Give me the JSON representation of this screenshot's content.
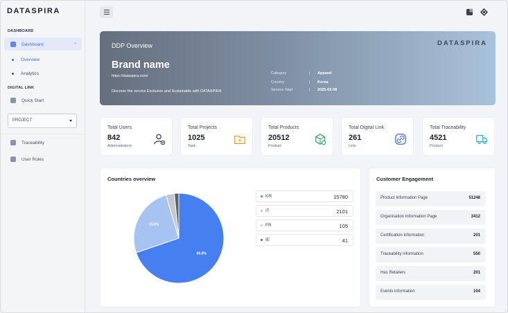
{
  "app": {
    "logo": "DATASPIRA"
  },
  "sidebar": {
    "section_dashboard": "DASHBOARD",
    "dashboard_label": "Dashboard",
    "sub_items": [
      {
        "label": "Overview",
        "active": true
      },
      {
        "label": "Analytics",
        "active": false
      }
    ],
    "section_digital_link": "DIGITAL LINK",
    "quick_start": "Quick Start",
    "project_select": "PROJECT",
    "traceability": "Traceability",
    "user_roles": "User Roles"
  },
  "hero": {
    "title": "DDP Overview",
    "brand": "Brand name",
    "url": "https://dataspira.com/",
    "description": "Discover the service Exclusive and Sustainable with DATASPIRA",
    "logo": "DATASPIRA",
    "meta": [
      {
        "key": "Category",
        "value": "Apparel"
      },
      {
        "key": "Country",
        "value": "Korea"
      },
      {
        "key": "Service Start",
        "value": "2025-02-08"
      }
    ],
    "separator": "|"
  },
  "stats": [
    {
      "title": "Total Users",
      "value": "842",
      "sub": "Administrators",
      "icon": "user-add-icon",
      "color": "#3a3f4c"
    },
    {
      "title": "Total Projects",
      "value": "1025",
      "sub": "Task",
      "icon": "folder-plus-icon",
      "color": "#f0a020"
    },
    {
      "title": "Total Products",
      "value": "20512",
      "sub": "Product",
      "icon": "box-check-icon",
      "color": "#2aa866"
    },
    {
      "title": "Total Digital Link",
      "value": "261",
      "sub": "Link",
      "icon": "link-icon",
      "color": "#3b6fe0"
    },
    {
      "title": "Total Traceability",
      "value": "4521",
      "sub": "Product",
      "icon": "truck-icon",
      "color": "#1fb0c8"
    }
  ],
  "countries_overview": {
    "title": "Countries overview",
    "rows": [
      {
        "code": "KR",
        "value": "15780",
        "color": "#4680f0"
      },
      {
        "code": "IT",
        "value": "2101",
        "color": "#a7c3f2"
      },
      {
        "code": "FR",
        "value": "105",
        "color": "#c4c8ce"
      },
      {
        "code": "IE",
        "value": "41",
        "color": "#5a6068"
      }
    ]
  },
  "chart_data": {
    "type": "pie",
    "categories": [
      "KR",
      "IT",
      "FR",
      "IE"
    ],
    "values": [
      69.8,
      25.6,
      3.0,
      1.6
    ],
    "labels": [
      "69.8%",
      "25.6%",
      "",
      ""
    ],
    "colors": [
      "#4680f0",
      "#a7c3f2",
      "#c4c8ce",
      "#5a6068"
    ],
    "title": "Countries overview"
  },
  "customer_engagement": {
    "title": "Customer Engagement",
    "rows": [
      {
        "label": "Product Information Page",
        "value": "51248"
      },
      {
        "label": "Organisation Information Page",
        "value": "3412"
      },
      {
        "label": "Certification Information",
        "value": "201"
      },
      {
        "label": "Traceability information",
        "value": "550"
      },
      {
        "label": "Has Retailers",
        "value": "201"
      },
      {
        "label": "Events information",
        "value": "104"
      }
    ]
  }
}
